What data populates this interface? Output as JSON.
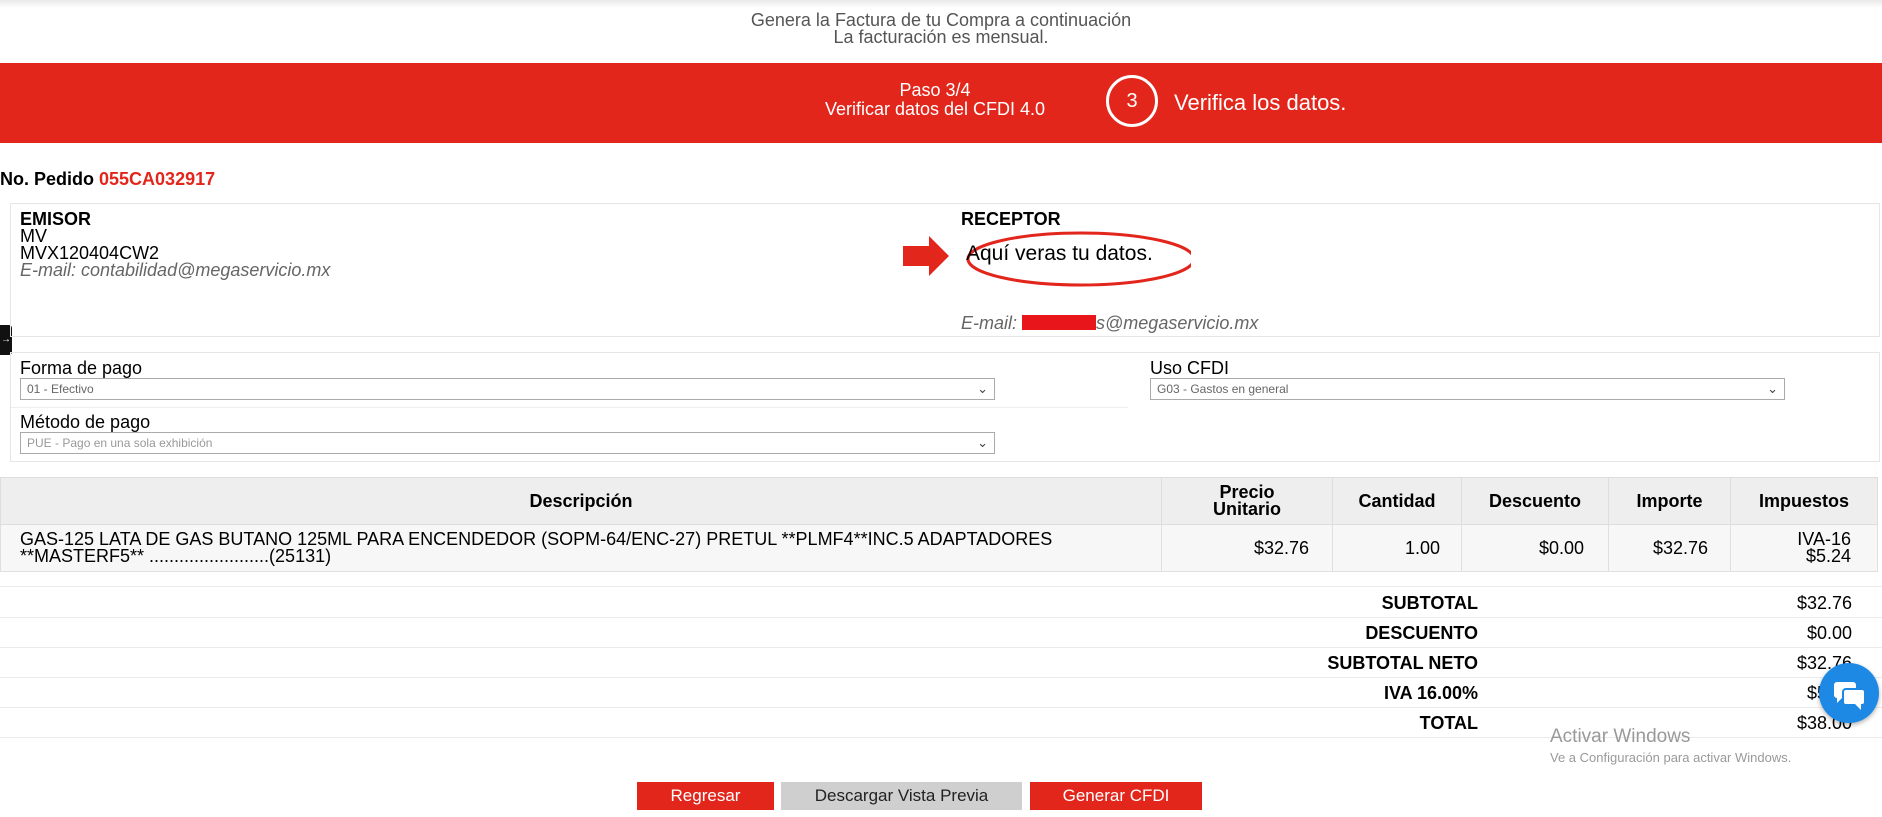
{
  "intro": {
    "line1": "Genera la Factura de tu Compra a continuación",
    "line2": "La facturación es mensual."
  },
  "banner": {
    "step": "Paso 3/4",
    "step_desc": "Verificar datos del CFDI 4.0",
    "step_number": "3",
    "callout": "Verifica los datos."
  },
  "order": {
    "label": "No. Pedido",
    "number": "055CA032917"
  },
  "emisor": {
    "title": "EMISOR",
    "name": "MV",
    "rfc": "MVX120404CW2",
    "email": "E-mail: contabilidad@megaservicio.mx"
  },
  "receptor": {
    "title": "RECEPTOR",
    "annotation": "Aquí veras tu datos.",
    "email_label": "E-mail:",
    "email_suffix": "s@megaservicio.mx"
  },
  "form": {
    "forma_pago": {
      "label": "Forma de pago",
      "value": "01 - Efectivo"
    },
    "uso_cfdi": {
      "label": "Uso CFDI",
      "value": "G03 - Gastos en general"
    },
    "metodo_pago": {
      "label": "Método de pago",
      "value": "PUE - Pago en una sola exhibición"
    }
  },
  "table": {
    "headers": {
      "descripcion": "Descripción",
      "precio1": "Precio",
      "precio2": "Unitario",
      "cantidad": "Cantidad",
      "descuento": "Descuento",
      "importe": "Importe",
      "impuestos": "Impuestos"
    },
    "row": {
      "descripcion1": "GAS-125 LATA DE GAS BUTANO 125ML PARA ENCENDEDOR (SOPM-64/ENC-27) PRETUL **PLMF4**INC.5 ADAPTADORES",
      "descripcion2": "**MASTERF5** ........................(25131)",
      "precio": "$32.76",
      "cantidad": "1.00",
      "descuento": "$0.00",
      "importe": "$32.76",
      "impuesto_tipo": "IVA-16",
      "impuesto_monto": "$5.24"
    }
  },
  "totals": [
    {
      "label": "SUBTOTAL",
      "value": "$32.76"
    },
    {
      "label": "DESCUENTO",
      "value": "$0.00"
    },
    {
      "label": "SUBTOTAL NETO",
      "value": "$32.76"
    },
    {
      "label": "IVA 16.00%",
      "value": "$5.24"
    },
    {
      "label": "TOTAL",
      "value": "$38.00"
    }
  ],
  "watermark": {
    "line1": "Activar Windows",
    "line2": "Ve a Configuración para activar Windows."
  },
  "buttons": {
    "regresar": "Regresar",
    "descargar": "Descargar Vista Previa",
    "generar": "Generar CFDI"
  },
  "colors": {
    "accent": "#e2261c",
    "chat": "#1e88e5"
  },
  "icons": {
    "chat": "chat-bubbles-icon",
    "side_tab": "arrow-right-icon",
    "callout_arrow": "red-arrow-icon"
  }
}
